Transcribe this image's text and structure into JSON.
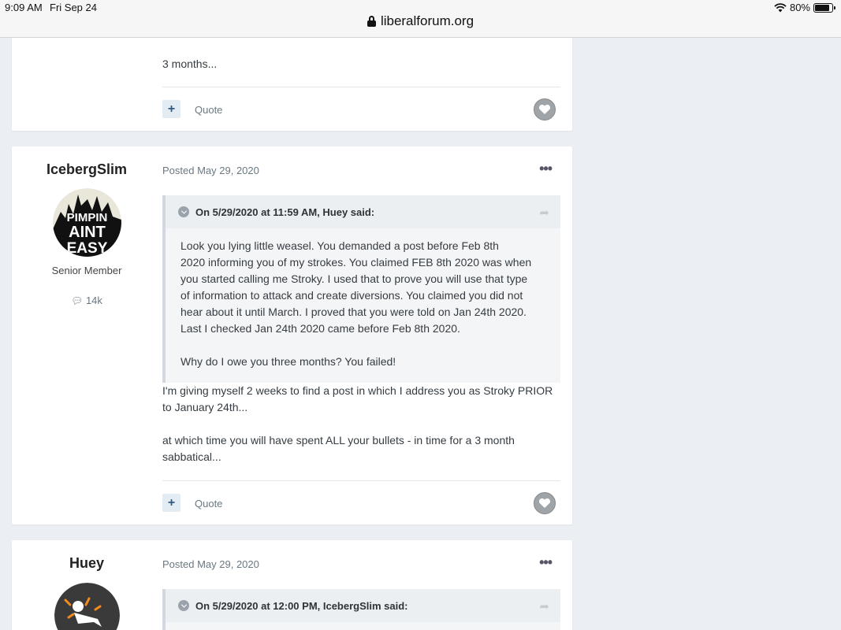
{
  "status_bar": {
    "time": "9:09 AM",
    "date": "Fri Sep 24",
    "battery": "80%"
  },
  "browser": {
    "url": "liberalforum.org"
  },
  "post_top": {
    "text": "3 months...",
    "quote_label": "Quote"
  },
  "post_iceberg": {
    "author": "IcebergSlim",
    "avatar_text": [
      "PIMPIN",
      "AINT",
      "EASY"
    ],
    "rank": "Senior Member",
    "post_count": "14k",
    "posted": "Posted May 29, 2020",
    "quote_header": "On 5/29/2020 at 11:59 AM, Huey said:",
    "quote_lines": [
      "Look you lying little weasel.  You demanded a post before Feb 8th",
      "2020 informing you of my strokes.  You claimed FEB 8th 2020 was when",
      "you started calling me Stroky.  I used that to prove you will use that type",
      "of information to attack and create diversions. You claimed you did not",
      "hear about it until March.  I proved that you were told on Jan 24th 2020.",
      "Last I checked Jan 24th 2020 came before Feb 8th 2020."
    ],
    "quote_last": "Why do I owe you three months?  You failed!",
    "body_p1_lines": [
      "I'm giving myself 2 weeks to find a post in which I address you as Stroky PRIOR",
      "to January 24th..."
    ],
    "body_p2_lines": [
      "at which time you will have spent ALL your bullets - in time for a 3 month",
      "sabbatical..."
    ],
    "quote_label": "Quote"
  },
  "post_huey": {
    "author": "Huey",
    "posted": "Posted May 29, 2020",
    "quote_header": "On 5/29/2020 at 12:00 PM, IcebergSlim said:"
  }
}
